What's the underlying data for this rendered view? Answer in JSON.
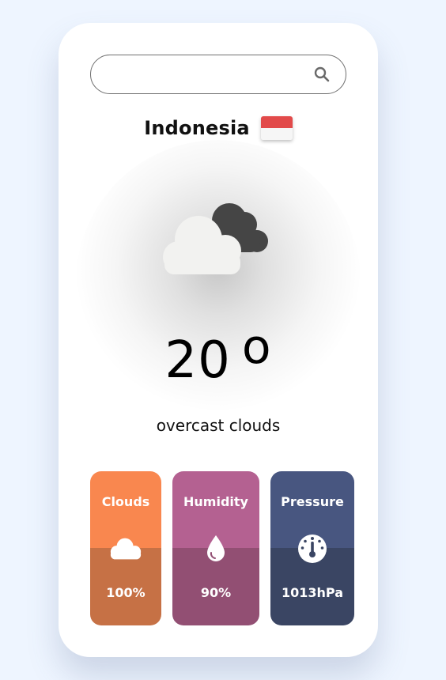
{
  "search": {
    "value": "",
    "placeholder": ""
  },
  "location": {
    "name": "Indonesia",
    "flag_icon": "indonesia-flag-icon"
  },
  "weather": {
    "icon": "overcast-clouds-icon",
    "temperature": "20",
    "degree_symbol": "o",
    "description": "overcast clouds"
  },
  "stats": {
    "clouds": {
      "label": "Clouds",
      "value": "100%",
      "icon": "cloud-icon",
      "color_top": "#f9874f",
      "color_bottom": "#c67145"
    },
    "humidity": {
      "label": "Humidity",
      "value": "90%",
      "icon": "water-drop-icon",
      "color_top": "#b46191",
      "color_bottom": "#924f73"
    },
    "pressure": {
      "label": "Pressure",
      "value": "1013hPa",
      "icon": "gauge-icon",
      "color_top": "#485680",
      "color_bottom": "#3a4563"
    }
  }
}
